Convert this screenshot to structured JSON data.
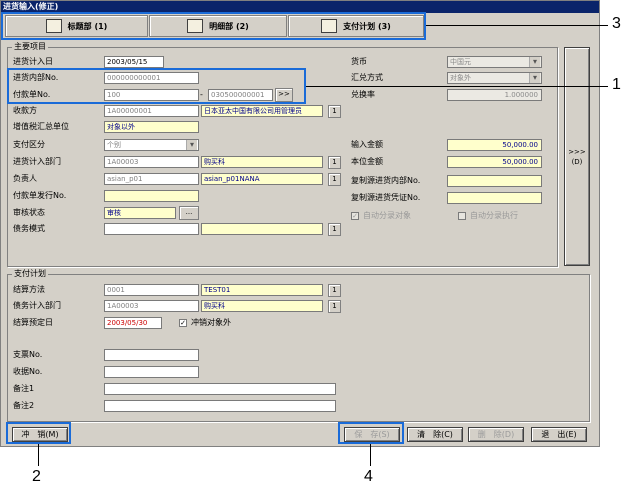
{
  "window": {
    "title": "进货输入(修正)"
  },
  "tabs": [
    {
      "label": "标题部 (1)",
      "icon": "book-icon"
    },
    {
      "label": "明细部 (2)",
      "icon": "notebook-icon"
    },
    {
      "label": "支付计划 (3)",
      "icon": "schedule-icon"
    }
  ],
  "main": {
    "group_title": "主要项目",
    "purchase_date": {
      "label": "进货计入日",
      "value": "2003/05/15"
    },
    "internal_no": {
      "label": "进货内部No.",
      "value": "000000000001"
    },
    "payment_no": {
      "label": "付款单No.",
      "value": "100",
      "dash": "-",
      "range_value": "030500000001",
      "range_btn": ">>"
    },
    "receiver": {
      "label": "收款方",
      "code": "1A00000001",
      "name": "日本亚太中国有限公司用管理员",
      "btn": "1"
    },
    "vat_unit": {
      "label": "增值税汇总单位",
      "value": "对象以外"
    },
    "payment_cat": {
      "label": "支付区分",
      "value": "个别"
    },
    "purchase_dept": {
      "label": "进货计入部门",
      "code": "1A00003",
      "name": "购买科",
      "btn": "1"
    },
    "person": {
      "label": "负责人",
      "code": "asian_p01",
      "name": "asian_p01NANA",
      "btn": "1"
    },
    "invoice_no": {
      "label": "付款单发行No.",
      "value": ""
    },
    "approval": {
      "label": "审核状态",
      "value": "审核",
      "btn": "..."
    },
    "debt_mode": {
      "label": "债务模式",
      "value": "",
      "btn": "1"
    },
    "currency": {
      "label": "货币",
      "value": "中国元"
    },
    "exchange": {
      "label": "汇兑方式",
      "value": "对象外"
    },
    "rate": {
      "label": "兑换率",
      "value": "1.000000"
    },
    "input_amount": {
      "label": "输入金额",
      "value": "50,000.00"
    },
    "local_amount": {
      "label": "本位金额",
      "value": "50,000.00"
    },
    "copy_internal": {
      "label": "复制源进货内部No.",
      "value": ""
    },
    "copy_voucher": {
      "label": "复制源进货凭证No.",
      "value": ""
    },
    "auto_split": {
      "label": "自动分录对象",
      "checked": true
    },
    "auto_split_exec": {
      "label": "自动分录执行",
      "checked": false
    },
    "side_btn": ">>>\n(D)"
  },
  "payplan": {
    "group_title": "支付计划",
    "method": {
      "label": "结算方法",
      "code": "0001",
      "name": "TEST01",
      "btn": "1"
    },
    "debt_dept": {
      "label": "债务计入部门",
      "code": "1A00003",
      "name": "购买科",
      "btn": "1"
    },
    "planned_date": {
      "label": "结算预定日",
      "value": "2003/05/30",
      "offset_label": "冲销对象外",
      "offset_checked": true
    },
    "check_no": {
      "label": "支票No.",
      "value": ""
    },
    "receipt_no": {
      "label": "收据No.",
      "value": ""
    },
    "note1": {
      "label": "备注1",
      "value": ""
    },
    "note2": {
      "label": "备注2",
      "value": ""
    }
  },
  "footer": {
    "offset_btn": "冲　销(M)",
    "save_btn": "保　存(S)",
    "clear_btn": "清　除(C)",
    "delete_btn": "删　除(D)",
    "exit_btn": "退　出(E)"
  },
  "annotations": [
    "1",
    "2",
    "3",
    "4"
  ],
  "colors": {
    "highlight": "#1a6bd8",
    "title_bar": "#0a246a",
    "window": "#d4d0c8",
    "yellow_field": "#ffffcc"
  }
}
